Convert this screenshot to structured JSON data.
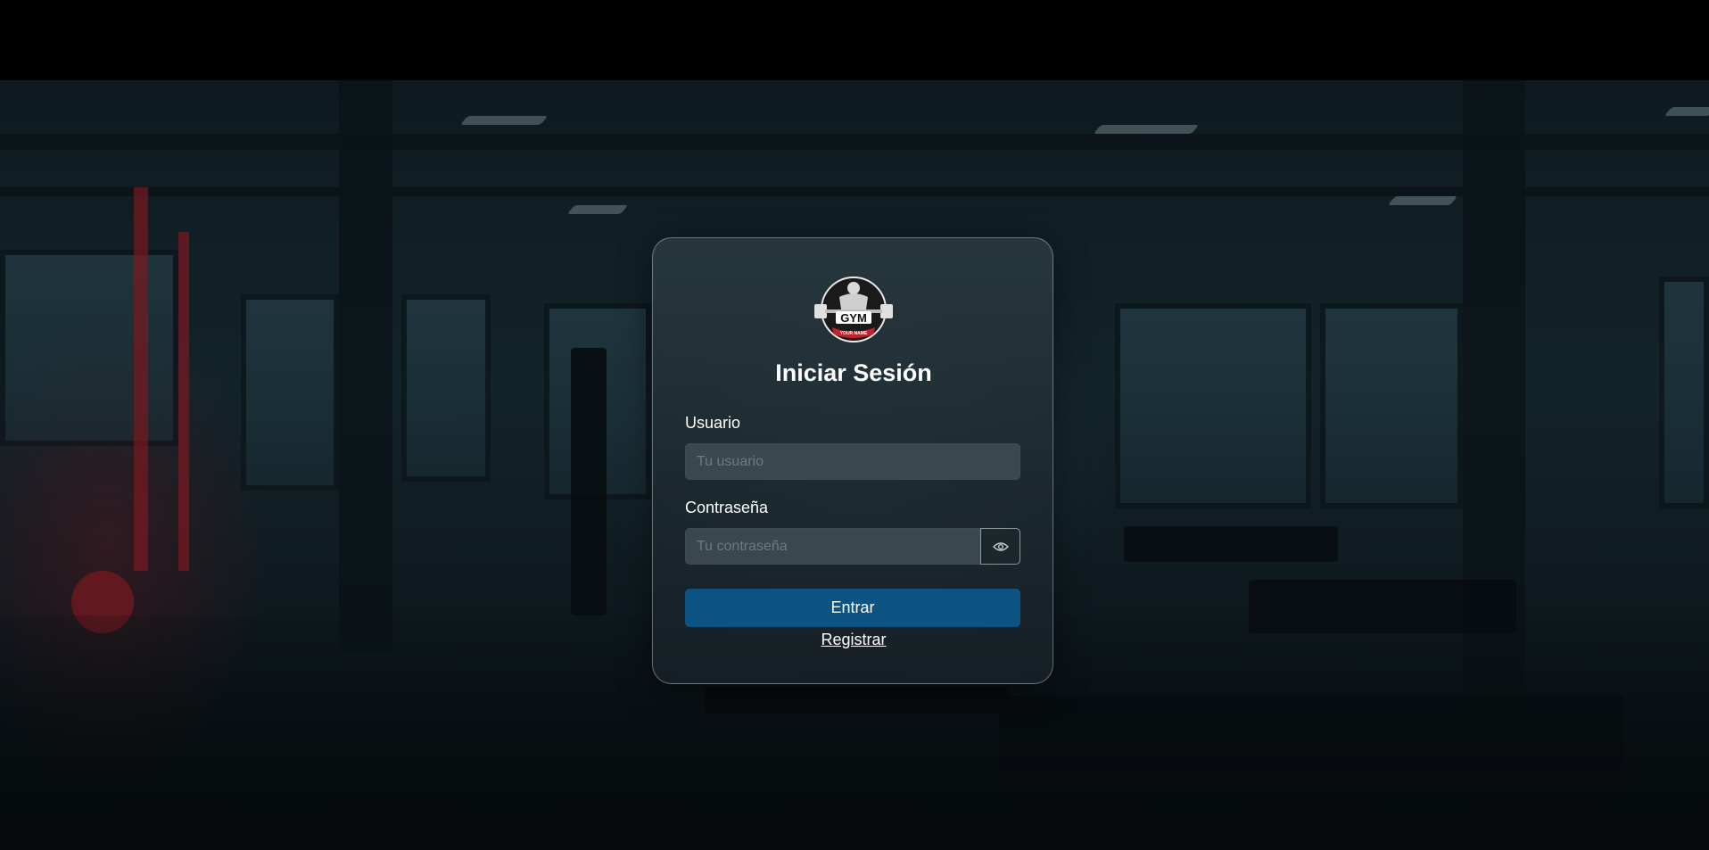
{
  "login": {
    "title": "Iniciar Sesión",
    "username_label": "Usuario",
    "username_placeholder": "Tu usuario",
    "username_value": "",
    "password_label": "Contraseña",
    "password_placeholder": "Tu contraseña",
    "password_value": "",
    "submit_label": "Entrar",
    "register_link": "Registrar"
  },
  "logo": {
    "text": "GYM",
    "subtext": "YOUR NAME"
  },
  "colors": {
    "primary_button": "#0d5381",
    "card_border": "#bfcdd2",
    "input_background": "#3a474d",
    "logo_accent": "#c8202a"
  },
  "icons": {
    "password_toggle": "eye-icon"
  }
}
